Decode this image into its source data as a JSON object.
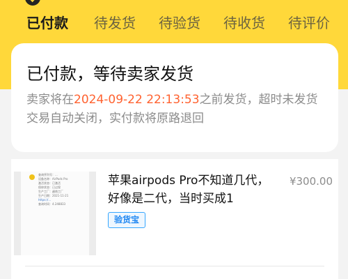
{
  "tabs": [
    {
      "label": "已付款"
    },
    {
      "label": "待发货"
    },
    {
      "label": "待验货"
    },
    {
      "label": "待收货"
    },
    {
      "label": "待评价"
    }
  ],
  "status": {
    "title": "已付款，等待卖家发货",
    "desc_prefix": "卖家将在",
    "deadline": "2024-09-22 22:13:53",
    "desc_suffix": "之前发货，超时未发货交易自动关闭，实付款将原路退回"
  },
  "order": {
    "title": "苹果airpods Pro不知道几代，好像是二代，当时买成1",
    "price": "¥300.00",
    "badge": "验货宝"
  },
  "image_text": {
    "lines": [
      "查询序列号：...",
      "设备名称：AirPods Pro",
      "激活状态：已激活",
      "保修状态：已过保",
      "生产工厂：越南工厂",
      "生产日期：2021-11-21",
      "https://...",
      "查询时间：4.248833"
    ]
  },
  "colors": {
    "yellow": "#ffd83a",
    "deadline": "#ff6230",
    "badge_blue": "#1f87f2",
    "muted_text": "#8b8b8b"
  },
  "icons": {
    "active_tab_check": "checkmark-circle-icon",
    "thumbnail_logo": "apple-logo-icon"
  }
}
